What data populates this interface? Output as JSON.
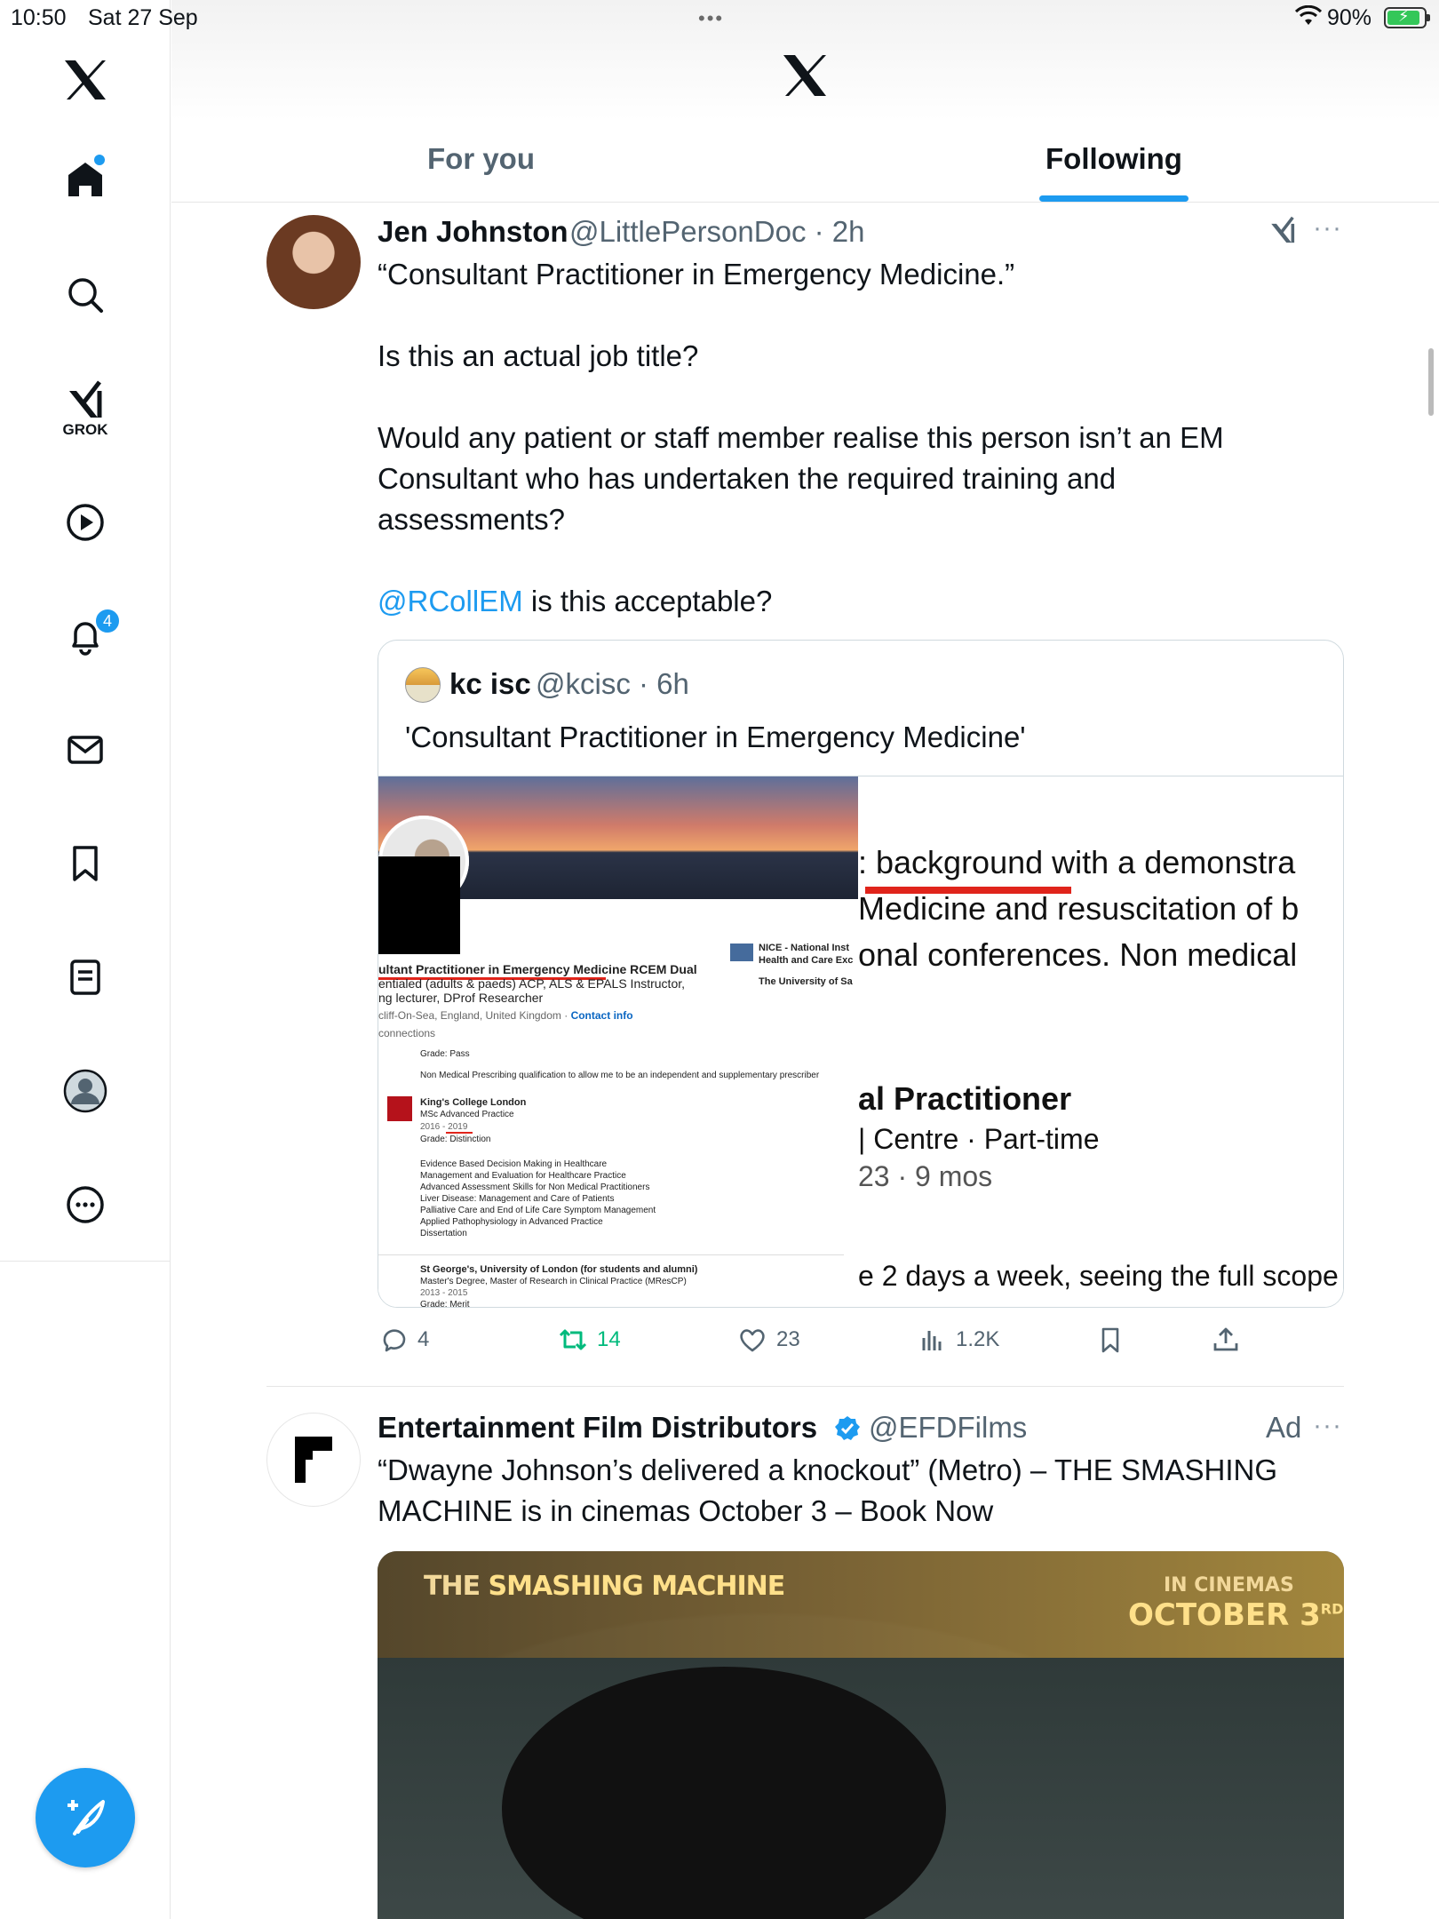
{
  "status_bar": {
    "time": "10:50",
    "date": "Sat 27 Sep",
    "battery": "90%",
    "battery_level": 0.9
  },
  "header": {
    "tabs": [
      {
        "label": "For you",
        "selected": false
      },
      {
        "label": "Following",
        "selected": true
      }
    ]
  },
  "sidebar": {
    "items": [
      {
        "icon": "x-logo-icon"
      },
      {
        "icon": "home-icon",
        "has_dot": true
      },
      {
        "icon": "search-icon"
      },
      {
        "icon": "grok-icon",
        "label": "GROK"
      },
      {
        "icon": "play-icon"
      },
      {
        "icon": "bell-icon",
        "badge": "4"
      },
      {
        "icon": "mail-icon"
      },
      {
        "icon": "bookmark-icon"
      },
      {
        "icon": "lists-icon"
      },
      {
        "icon": "profile-icon"
      },
      {
        "icon": "more-icon"
      }
    ],
    "compose_icon": "compose-icon"
  },
  "tweets": [
    {
      "name": "Jen Johnston",
      "handle": "@LittlePersonDoc",
      "time": "2h",
      "text_line1": "“Consultant Practitioner in Emergency Medicine.”",
      "text_line2": "Is this an actual job title?",
      "text_line3": "Would any patient or staff member realise this person isn’t an EM\nConsultant who has undertaken the required training and\nassessments?",
      "mention": "@RCollEM",
      "text_line4": " is this acceptable?",
      "quote": {
        "name": "kc isc",
        "handle": "@kcisc",
        "time": "6h",
        "text": "'Consultant Practitioner in Emergency Medicine'",
        "image_left_lines": [
          "ultant Practitioner in Emergency Medicine RCEM Dual",
          "entialed (adults & paeds) ACP, ALS & EPALS Instructor,",
          "ng lecturer, DProf Researcher",
          "cliff-On-Sea, England, United Kingdom · ",
          "Contact info",
          "connections",
          "Grade: Pass",
          "Non Medical Prescribing qualification to allow me to be an independent and supplementary prescriber",
          "King's College London",
          "MSc Advanced Practice",
          "2016 - 2019",
          "Grade: Distinction",
          "Evidence Based Decision Making in Healthcare\nManagement and Evaluation for Healthcare Practice\nAdvanced Assessment Skills for Non Medical Practitioners\nLiver Disease: Management and Care of Patients\nPalliative Care and End of Life Care Symptom Management\nApplied Pathophysiology in Advanced Practice\nDissertation",
          "St George's, University of London (for students and alumni)",
          "Master's Degree, Master of Research in Clinical Practice (MResCP)",
          "2013 - 2015",
          "Grade: Merit",
          "NICE - National Inst\nHealth and Care Exc",
          "The University of Sa",
          "K",
          "NICE"
        ],
        "image_right_lines": [
          ": background with a demonstra",
          "Medicine and resuscitation of b",
          "onal conferences. Non medical",
          "al Practitioner",
          "| Centre · Part-time",
          "23 · 9 mos",
          "e 2 days a week, seeing the full scope"
        ]
      },
      "actions": {
        "replies": "4",
        "reposts": "14",
        "likes": "23",
        "views": "1.2K"
      }
    },
    {
      "name": "Entertainment Film Distributors",
      "handle": "@EFDFilms",
      "ad_label": "Ad",
      "text": "“Dwayne Johnson’s delivered a knockout” (Metro) – THE SMASHING\nMACHINE is in cinemas October 3 – Book Now",
      "video": {
        "title_prefix": "THE ",
        "title_main": "SMASHING MACHINE",
        "date_line1": "IN CINEMAS",
        "date_line2": "OCTOBER 3",
        "date_suffix": "RD"
      }
    }
  ],
  "colors": {
    "accent": "#1d9bf0",
    "secondary_text": "#536471",
    "repost_green": "#00ba7c"
  }
}
